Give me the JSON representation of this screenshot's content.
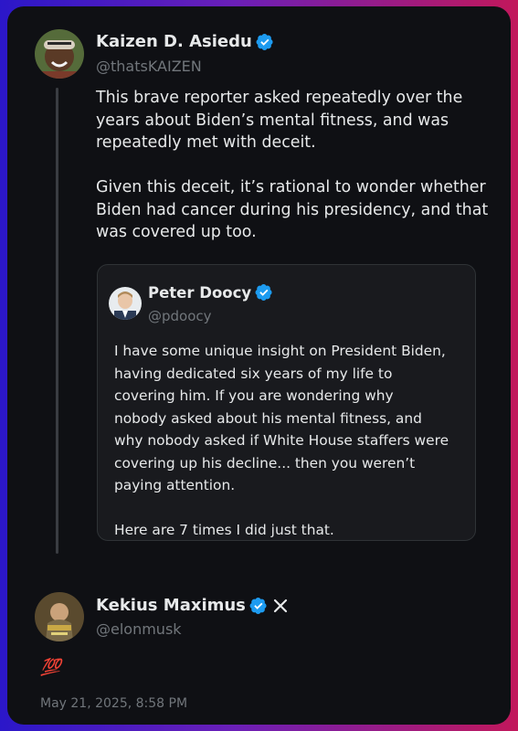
{
  "tweet": {
    "author_name": "Kaizen D. Asiedu",
    "author_handle": "@thatsKAIZEN",
    "text": "This brave reporter asked repeatedly over the\nyears about Biden’s mental fitness, and was\nrepeatedly met with deceit.\n\nGiven this deceit, it’s rational to wonder whether\nBiden had cancer during his presidency, and that\nwas covered up too."
  },
  "quoted": {
    "author_name": "Peter Doocy",
    "author_handle": "@pdoocy",
    "text": "I have some unique insight on President Biden,\nhaving dedicated six years of my life to\ncovering him. If you are wondering why\nnobody asked about his mental fitness, and\nwhy nobody asked if White House staffers were\ncovering up his decline... then you weren’t\npaying attention.\n\nHere are 7 times I did just that."
  },
  "reply": {
    "author_name": "Kekius Maximus",
    "author_handle": "@elonmusk",
    "text": "💯",
    "timestamp": "May 21, 2025, 8:58 PM"
  },
  "colors": {
    "verified_badge": "#1d9bf0",
    "text": "#e7e9ea",
    "muted": "#71767b"
  }
}
